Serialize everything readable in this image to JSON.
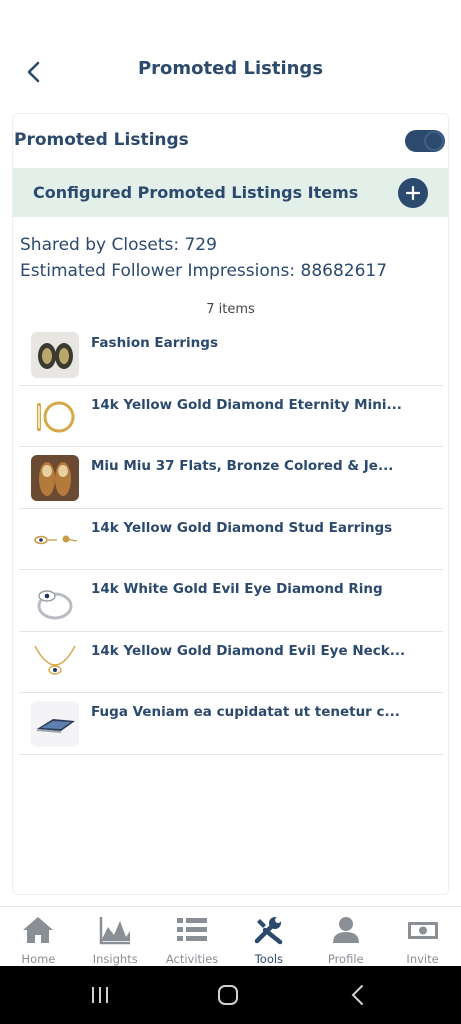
{
  "header": {
    "title": "Promoted Listings"
  },
  "toggle": {
    "label": "Promoted Listings",
    "enabled": true
  },
  "configured": {
    "label": "Configured Promoted Listings Items"
  },
  "stats": {
    "shared": "Shared by Closets: 729",
    "impressions": "Estimated Follower Impressions: 88682617"
  },
  "list": {
    "count": "7 items",
    "items": [
      {
        "title": "Fashion Earrings"
      },
      {
        "title": "14k Yellow Gold Diamond Eternity Mini..."
      },
      {
        "title": "Miu Miu 37 Flats, Bronze Colored & Je..."
      },
      {
        "title": "14k Yellow Gold Diamond Stud Earrings"
      },
      {
        "title": "14k White Gold Evil Eye Diamond Ring"
      },
      {
        "title": "14k Yellow Gold Diamond Evil Eye Neck..."
      },
      {
        "title": "Fuga Veniam ea cupidatat ut tenetur c..."
      }
    ]
  },
  "nav": {
    "items": [
      {
        "label": "Home",
        "icon": "home-icon"
      },
      {
        "label": "Insights",
        "icon": "chart-icon"
      },
      {
        "label": "Activities",
        "icon": "list-icon"
      },
      {
        "label": "Tools",
        "icon": "tools-icon",
        "active": true
      },
      {
        "label": "Profile",
        "icon": "person-icon"
      },
      {
        "label": "Invite",
        "icon": "money-icon"
      }
    ]
  },
  "colors": {
    "primary": "#2c4a6e",
    "accent_bg": "#e3efe9",
    "inactive": "#8a8f96"
  }
}
